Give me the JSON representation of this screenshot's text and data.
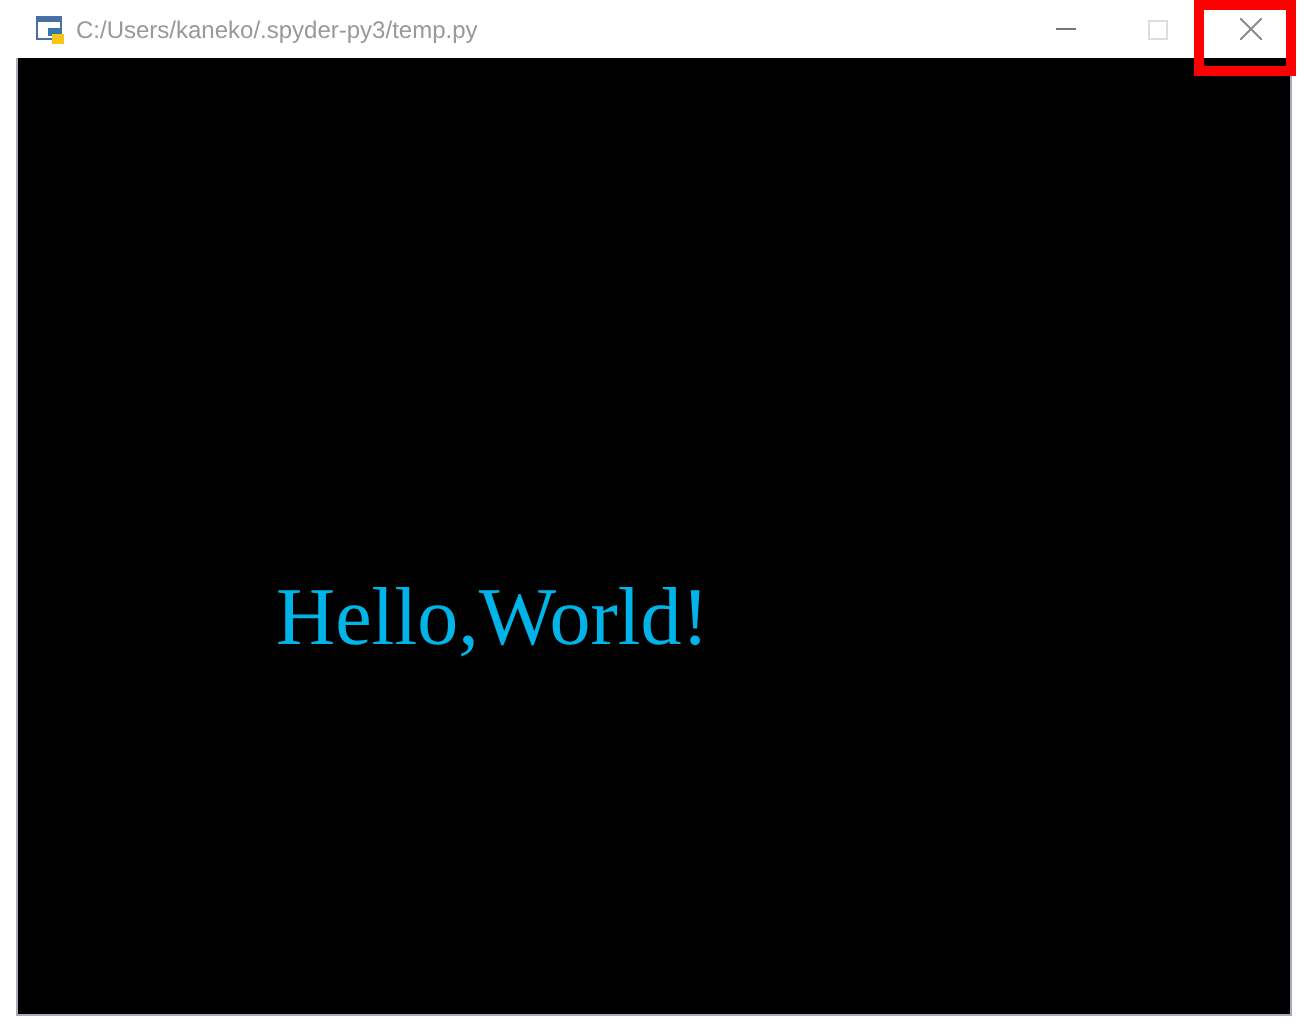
{
  "window": {
    "title": "C:/Users/kaneko/.spyder-py3/temp.py",
    "maximize_disabled": true,
    "close_highlighted": true
  },
  "canvas": {
    "text": "Hello,World!",
    "color": "#00b4e8"
  }
}
